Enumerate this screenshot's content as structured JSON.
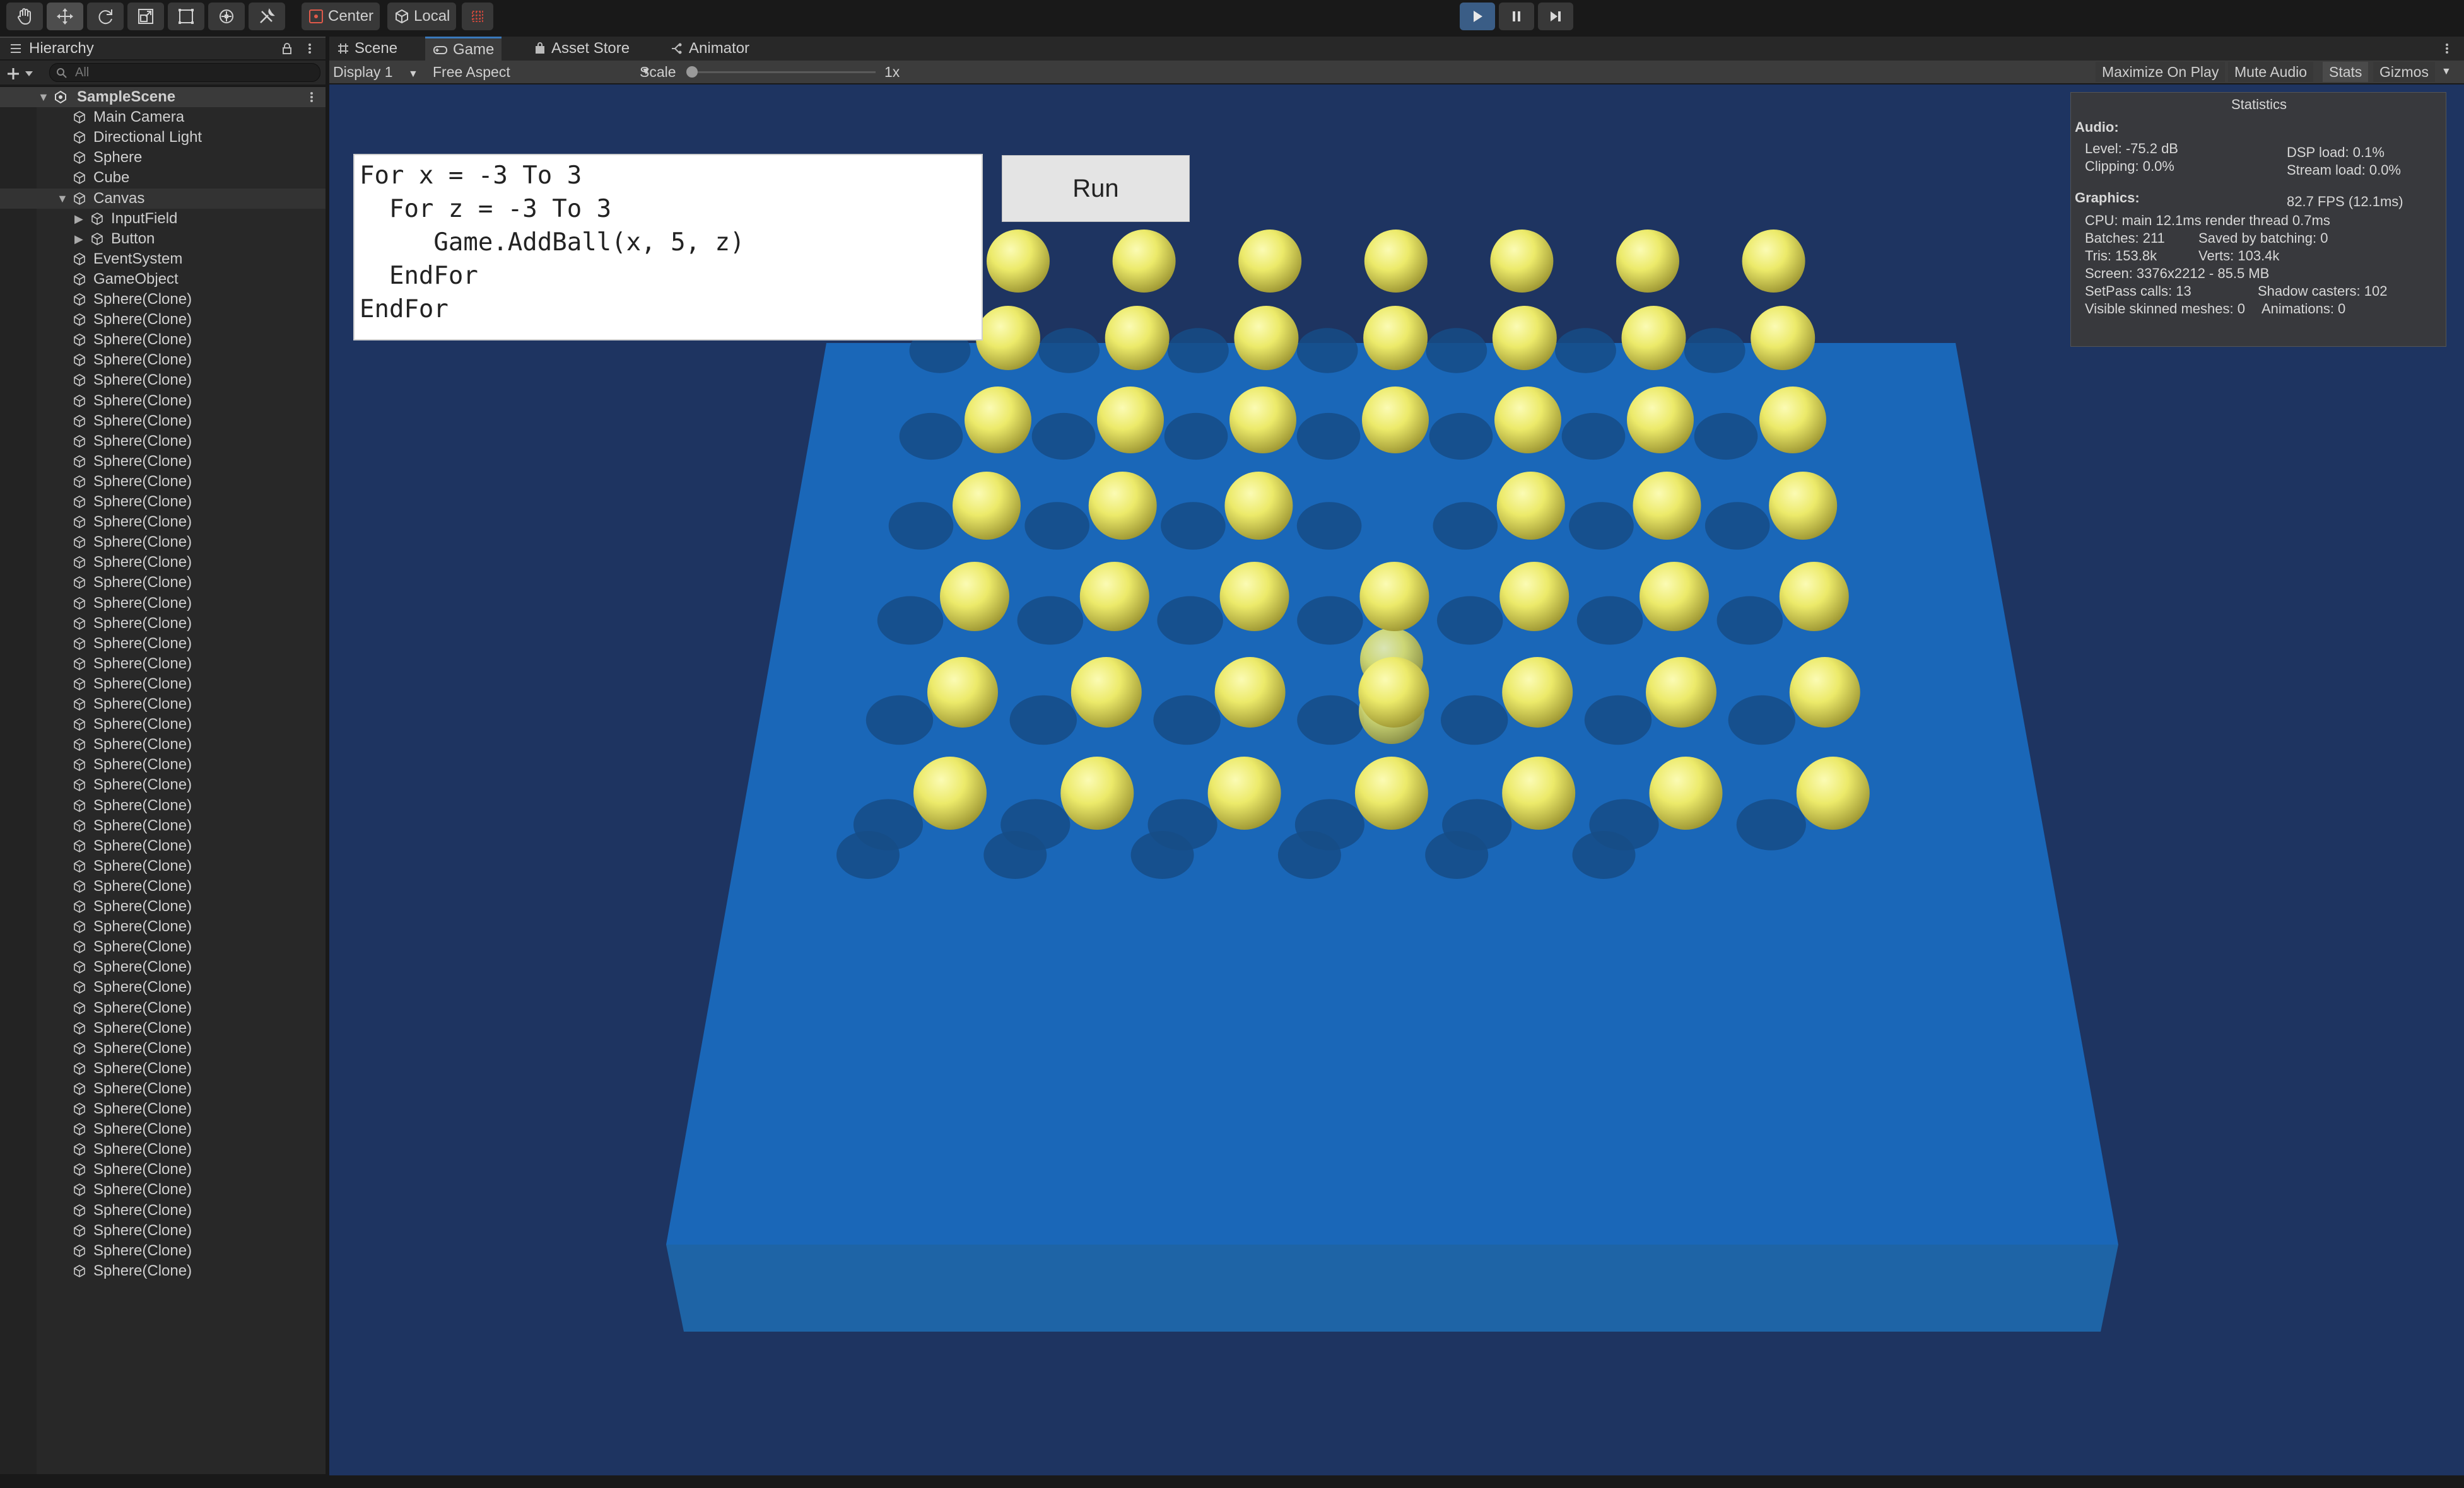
{
  "toolbar": {
    "tools": [
      "hand-tool",
      "move-tool",
      "rotate-tool",
      "scale-tool",
      "rect-tool",
      "transform-tool",
      "custom-tool"
    ],
    "pivot_label": "Center",
    "space_label": "Local"
  },
  "hierarchy": {
    "tab_label": "Hierarchy",
    "search_placeholder": "All",
    "scene_name": "SampleScene",
    "items": [
      "Main Camera",
      "Directional Light",
      "Sphere",
      "Cube",
      "Canvas",
      "InputField",
      "Button",
      "EventSystem",
      "GameObject",
      "Sphere(Clone)",
      "Sphere(Clone)",
      "Sphere(Clone)",
      "Sphere(Clone)",
      "Sphere(Clone)",
      "Sphere(Clone)",
      "Sphere(Clone)",
      "Sphere(Clone)",
      "Sphere(Clone)",
      "Sphere(Clone)",
      "Sphere(Clone)",
      "Sphere(Clone)",
      "Sphere(Clone)",
      "Sphere(Clone)",
      "Sphere(Clone)",
      "Sphere(Clone)",
      "Sphere(Clone)",
      "Sphere(Clone)",
      "Sphere(Clone)",
      "Sphere(Clone)",
      "Sphere(Clone)",
      "Sphere(Clone)",
      "Sphere(Clone)",
      "Sphere(Clone)",
      "Sphere(Clone)",
      "Sphere(Clone)",
      "Sphere(Clone)",
      "Sphere(Clone)",
      "Sphere(Clone)",
      "Sphere(Clone)",
      "Sphere(Clone)",
      "Sphere(Clone)",
      "Sphere(Clone)",
      "Sphere(Clone)",
      "Sphere(Clone)",
      "Sphere(Clone)",
      "Sphere(Clone)",
      "Sphere(Clone)",
      "Sphere(Clone)",
      "Sphere(Clone)",
      "Sphere(Clone)",
      "Sphere(Clone)",
      "Sphere(Clone)",
      "Sphere(Clone)",
      "Sphere(Clone)",
      "Sphere(Clone)",
      "Sphere(Clone)",
      "Sphere(Clone)",
      "Sphere(Clone)"
    ]
  },
  "tabs": {
    "scene": "Scene",
    "game": "Game",
    "asset_store": "Asset Store",
    "animator": "Animator"
  },
  "game_bar": {
    "display": "Display 1",
    "aspect": "Free Aspect",
    "scale_label": "Scale",
    "scale_value": "1x",
    "maximize": "Maximize On Play",
    "mute": "Mute Audio",
    "stats": "Stats",
    "gizmos": "Gizmos"
  },
  "game": {
    "code_lines": [
      "For x = -3 To 3",
      "  For z = -3 To 3",
      "     Game.AddBall(x, 5, z)",
      "  EndFor",
      "EndFor"
    ],
    "run_label": "Run"
  },
  "stats": {
    "title": "Statistics",
    "audio_header": "Audio:",
    "level": "Level: -75.2 dB",
    "clipping": "Clipping: 0.0%",
    "dsp_load": "DSP load: 0.1%",
    "stream_load": "Stream load: 0.0%",
    "graphics_header": "Graphics:",
    "fps": "82.7 FPS (12.1ms)",
    "cpu": "CPU: main 12.1ms  render thread 0.7ms",
    "batches": "Batches: 211",
    "saved_batching": "Saved by batching: 0",
    "tris": "Tris: 153.8k",
    "verts": "Verts: 103.4k",
    "screen": "Screen: 3376x2212 - 85.5 MB",
    "setpass": "SetPass calls: 13",
    "shadow_casters": "Shadow casters: 102",
    "skinned": "Visible skinned meshes: 0",
    "animations": "Animations: 0"
  },
  "colors": {
    "editor_bg": "#191919",
    "panel_bg": "#282828",
    "sky": "#1e3461",
    "board": "#1a67b8",
    "ball": "#e9e66a",
    "play_active": "#3a5d86"
  }
}
